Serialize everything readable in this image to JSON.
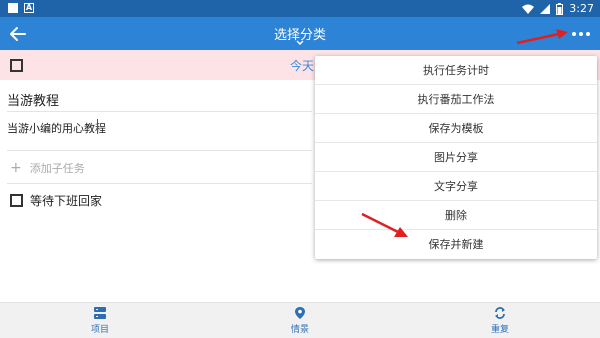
{
  "status_bar": {
    "time": "3:27"
  },
  "app_bar": {
    "title": "选择分类"
  },
  "today_row": {
    "label": "今天"
  },
  "task": {
    "title": "当游教程",
    "note": "当游小编的用心教程",
    "add_subtask_label": "添加子任务",
    "subtask": "等待下班回家"
  },
  "menu": {
    "items": [
      "执行任务计时",
      "执行番茄工作法",
      "保存为模板",
      "图片分享",
      "文字分享",
      "删除",
      "保存并新建"
    ]
  },
  "bottom_nav": {
    "items": [
      {
        "label": "项目",
        "icon": "storage-icon"
      },
      {
        "label": "情景",
        "icon": "location-pin-icon"
      },
      {
        "label": "重复",
        "icon": "sync-icon"
      }
    ]
  },
  "colors": {
    "status_bar": "#1f63a8",
    "app_bar": "#2d84d6",
    "today_row_bg": "#fde3e6",
    "accent_text": "#3a8ad8",
    "annotation_arrow": "#e02020"
  }
}
